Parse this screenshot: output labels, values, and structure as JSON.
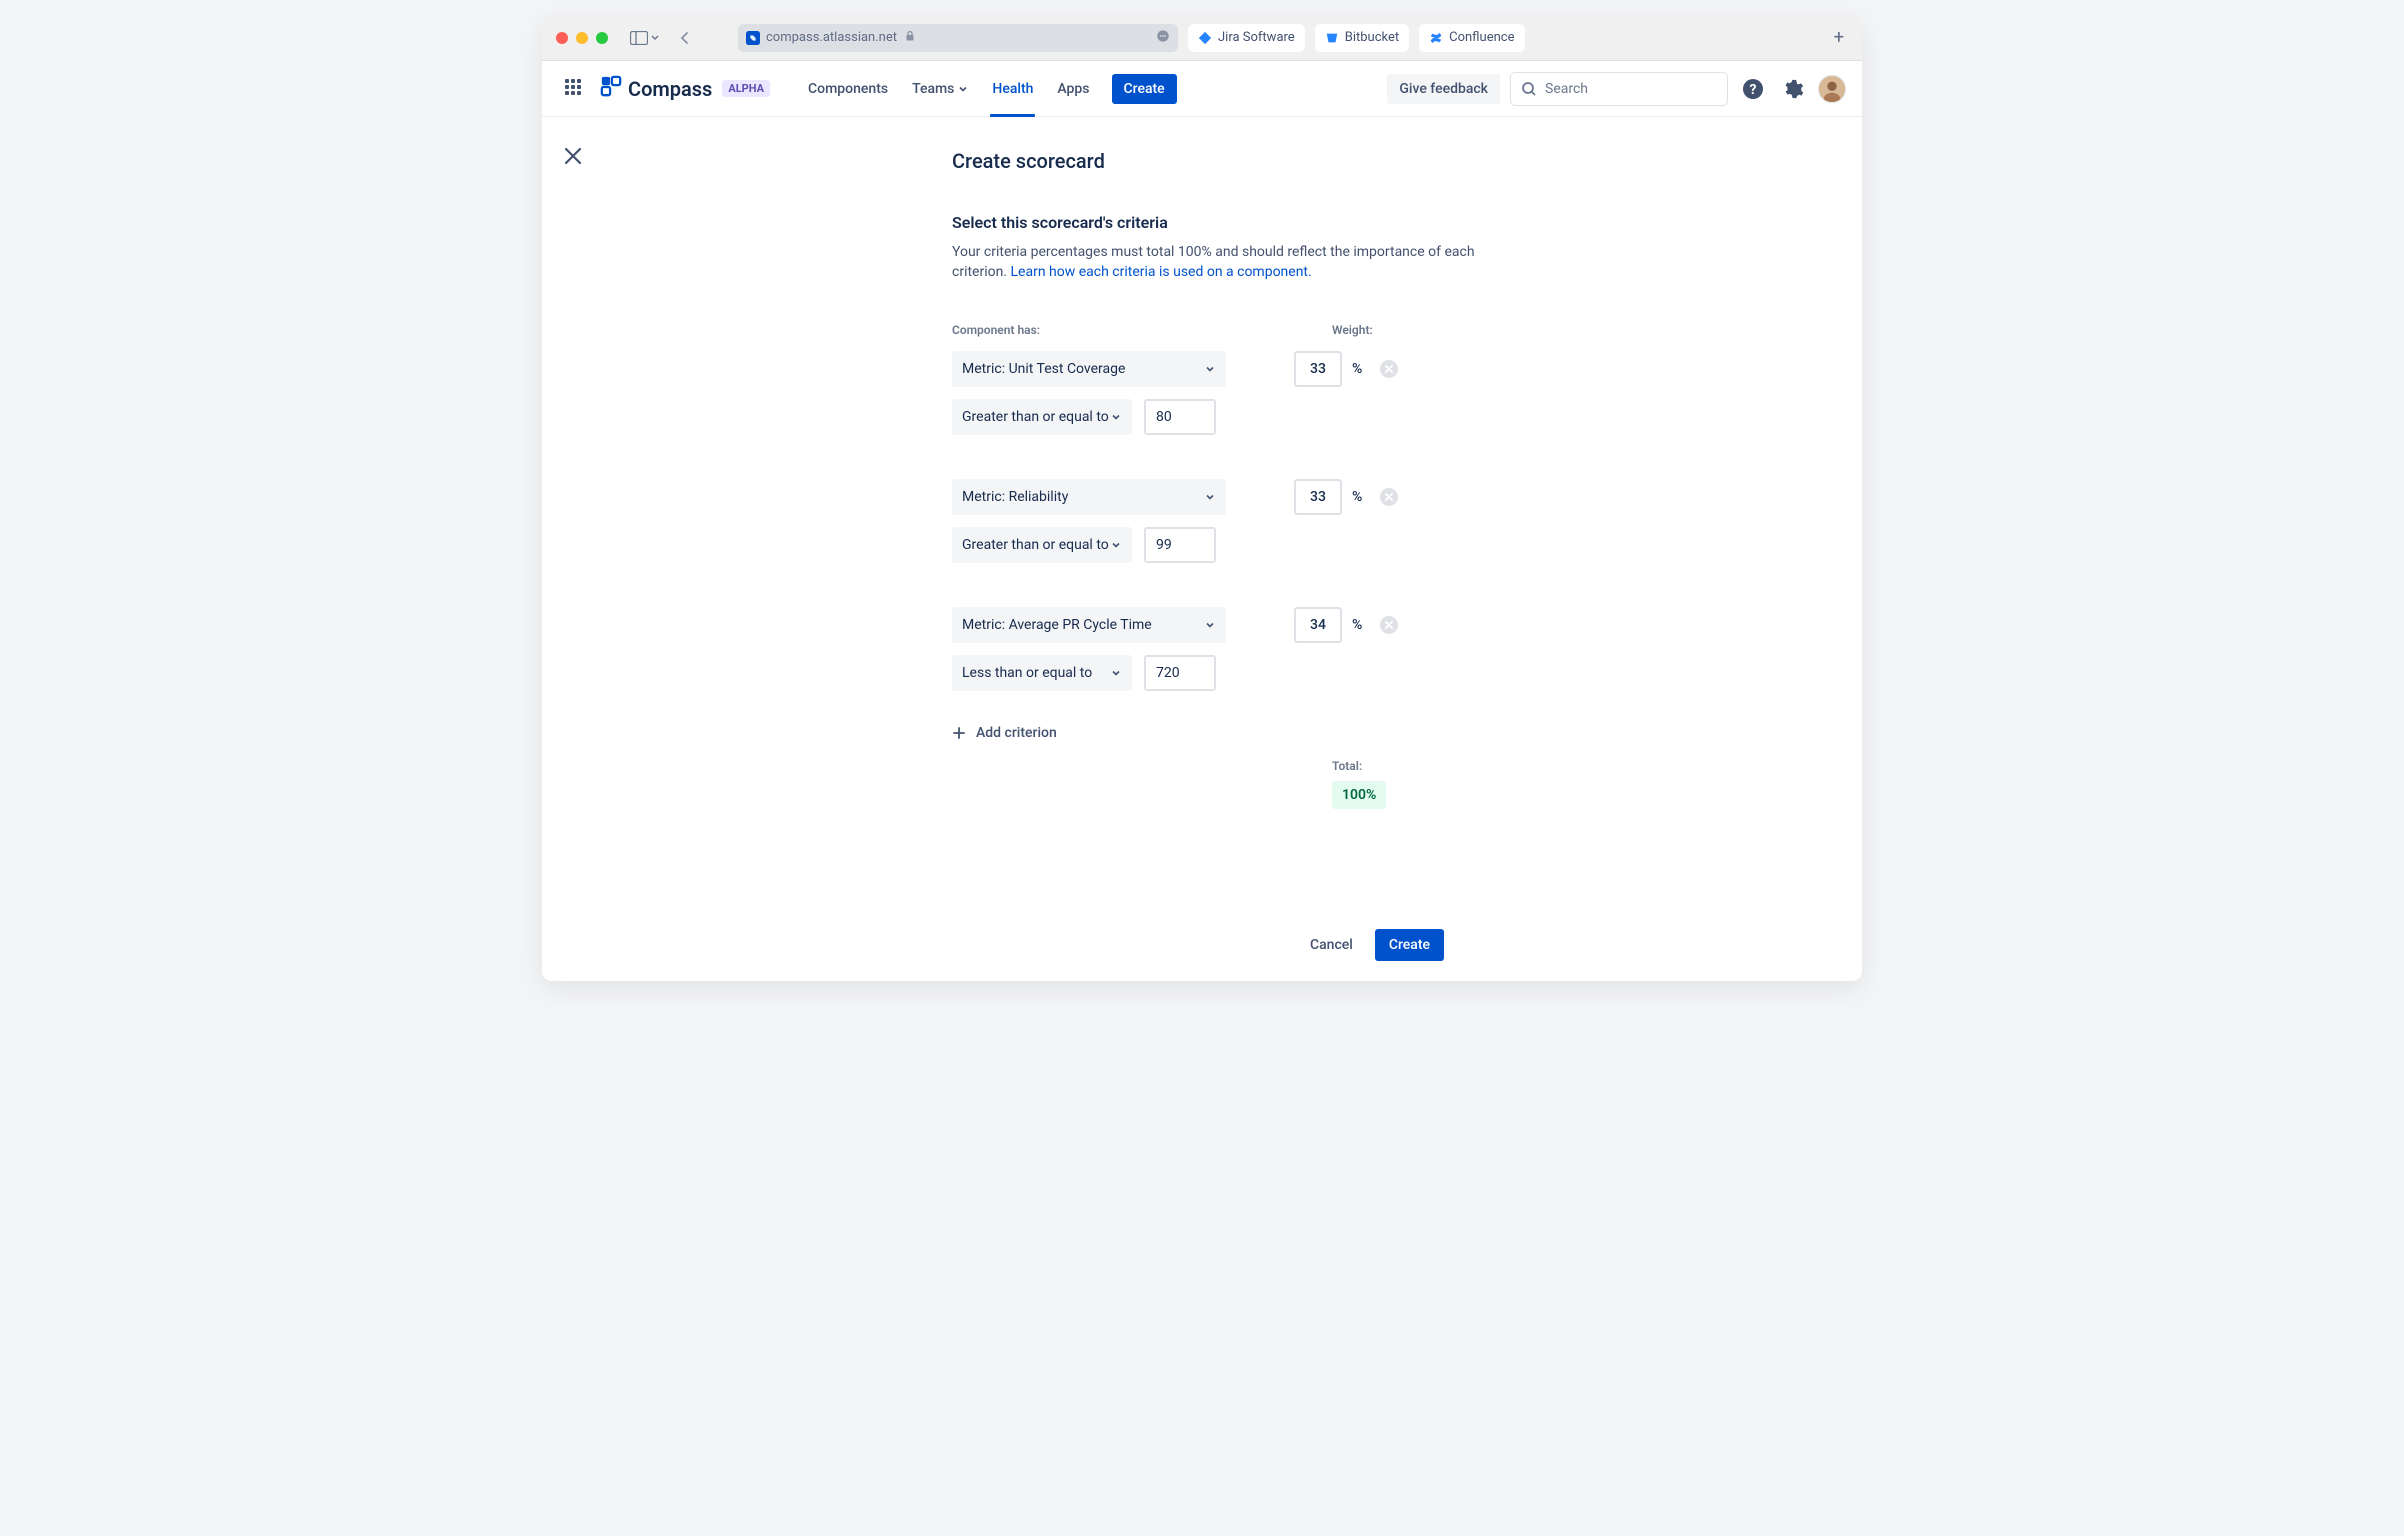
{
  "browser": {
    "url": "compass.atlassian.net",
    "favorites": [
      {
        "label": "Jira Software",
        "icon": "jira"
      },
      {
        "label": "Bitbucket",
        "icon": "bitbucket"
      },
      {
        "label": "Confluence",
        "icon": "confluence"
      }
    ]
  },
  "header": {
    "product": "Compass",
    "badge": "ALPHA",
    "nav": {
      "components": "Components",
      "teams": "Teams",
      "health": "Health",
      "apps": "Apps"
    },
    "create": "Create",
    "feedback": "Give feedback",
    "search_placeholder": "Search"
  },
  "page": {
    "title": "Create scorecard",
    "section_title": "Select this scorecard's criteria",
    "description_prefix": "Your criteria percentages must total 100% and should reflect the importance of each criterion. ",
    "description_link": "Learn how each criteria is used on a component.",
    "col_component": "Component has:",
    "col_weight": "Weight:",
    "percent_sign": "%",
    "add_criterion": "Add criterion",
    "total_label": "Total:",
    "total_value": "100%",
    "cancel": "Cancel",
    "create": "Create"
  },
  "criteria": [
    {
      "metric": "Metric: Unit Test Coverage",
      "operator": "Greater than or equal to",
      "value": "80",
      "weight": "33"
    },
    {
      "metric": "Metric: Reliability",
      "operator": "Greater than or equal to",
      "value": "99",
      "weight": "33"
    },
    {
      "metric": "Metric: Average PR Cycle Time",
      "operator": "Less than or equal to",
      "value": "720",
      "weight": "34"
    }
  ]
}
